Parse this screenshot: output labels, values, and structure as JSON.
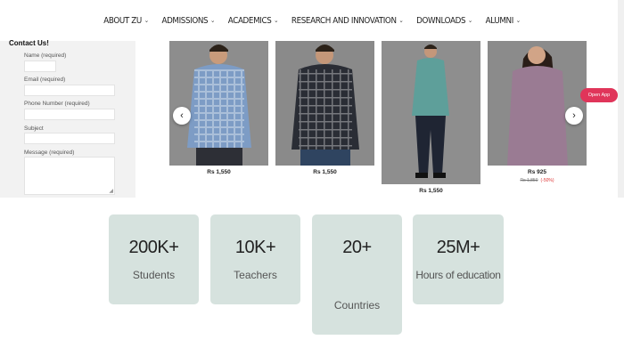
{
  "nav": {
    "items": [
      {
        "label": "ABOUT ZU"
      },
      {
        "label": "ADMISSIONS"
      },
      {
        "label": "ACADEMICS"
      },
      {
        "label": "RESEARCH AND INNOVATION"
      },
      {
        "label": "DOWNLOADS"
      },
      {
        "label": "ALUMNI"
      }
    ]
  },
  "contact": {
    "title": "Contact Us!",
    "fields": [
      {
        "label": "Name (required)"
      },
      {
        "label": "Email (required)"
      },
      {
        "label": "Phone Number (required)"
      },
      {
        "label": "Subject"
      },
      {
        "label": "Message (required)"
      }
    ]
  },
  "products": [
    {
      "price": "Rs 1,550",
      "shirt": "#7d9cc5",
      "pants": "#2d2f36"
    },
    {
      "price": "Rs 1,550",
      "shirt": "#2a2d35",
      "pants": "#2f4460"
    },
    {
      "price": "Rs 1,550",
      "shirt": "#5e9f9a",
      "pants": "#1f2533"
    },
    {
      "price": "Rs 925",
      "old_price": "Rs 1,850",
      "discount": "(-50%)",
      "shirt": "#9a7b93",
      "pants": "#6d5868"
    }
  ],
  "open_app": "Open App",
  "stats": [
    {
      "number": "200K+",
      "label": "Students"
    },
    {
      "number": "10K+",
      "label": "Teachers"
    },
    {
      "number": "20+",
      "label": "Countries"
    },
    {
      "number": "25M+",
      "label": "Hours of education"
    }
  ]
}
